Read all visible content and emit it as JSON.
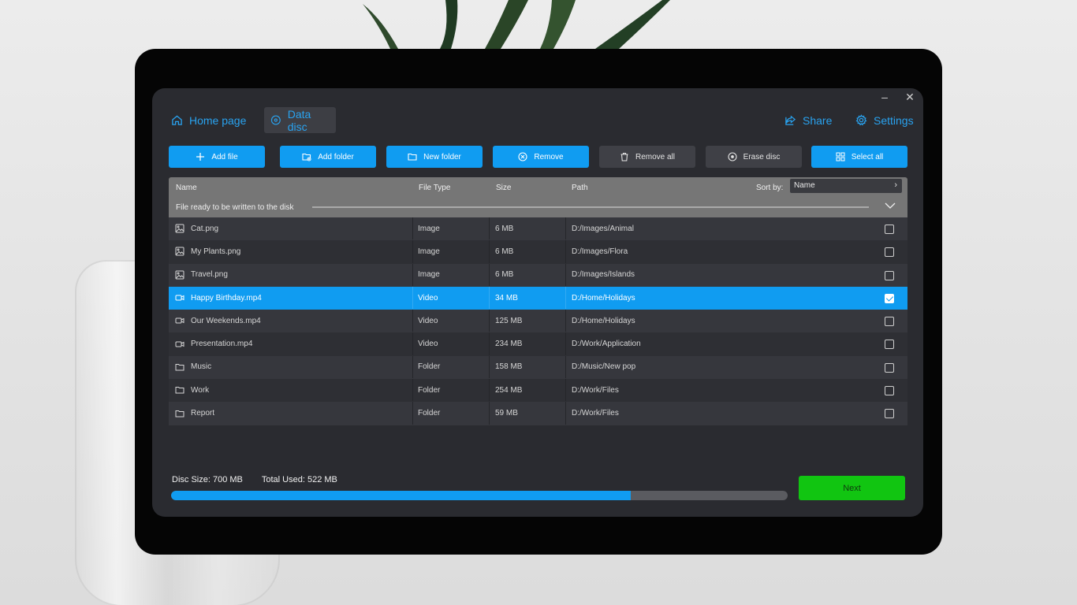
{
  "window": {
    "minimize_glyph": "–",
    "close_glyph": "✕"
  },
  "nav": {
    "home": {
      "label": "Home page",
      "icon": "home-icon"
    },
    "data_disc": {
      "label": "Data disc",
      "icon": "disc-icon",
      "active": true
    },
    "share": {
      "label": "Share",
      "icon": "share-icon"
    },
    "settings": {
      "label": "Settings",
      "icon": "gear-icon"
    }
  },
  "toolbar": {
    "add_file": "Add file",
    "add_folder": "Add folder",
    "new_folder": "New folder",
    "remove": "Remove",
    "remove_all": "Remove all",
    "erase_disc": "Erase disc",
    "select_all": "Select all"
  },
  "table": {
    "columns": {
      "name": "Name",
      "type": "File Type",
      "size": "Size",
      "path": "Path"
    },
    "sort_label": "Sort by:",
    "sort_value": "Name",
    "ready_text": "File ready to be written to the disk",
    "rows": [
      {
        "name": "Cat.png",
        "type": "Image",
        "size": "6 MB",
        "path": "D:/Images/Animal",
        "kind": "image",
        "checked": false
      },
      {
        "name": "My Plants.png",
        "type": "Image",
        "size": "6 MB",
        "path": "D:/Images/Flora",
        "kind": "image",
        "checked": false
      },
      {
        "name": "Travel.png",
        "type": "Image",
        "size": "6 MB",
        "path": "D:/Images/Islands",
        "kind": "image",
        "checked": false
      },
      {
        "name": "Happy Birthday.mp4",
        "type": "Video",
        "size": "34 MB",
        "path": "D:/Home/Holidays",
        "kind": "video",
        "checked": true
      },
      {
        "name": "Our Weekends.mp4",
        "type": "Video",
        "size": "125 MB",
        "path": "D:/Home/Holidays",
        "kind": "video",
        "checked": false
      },
      {
        "name": "Presentation.mp4",
        "type": "Video",
        "size": "234 MB",
        "path": "D:/Work/Application",
        "kind": "video",
        "checked": false
      },
      {
        "name": "Music",
        "type": "Folder",
        "size": "158 MB",
        "path": "D:/Music/New pop",
        "kind": "folder",
        "checked": false
      },
      {
        "name": "Work",
        "type": "Folder",
        "size": "254 MB",
        "path": "D:/Work/Files",
        "kind": "folder",
        "checked": false
      },
      {
        "name": "Report",
        "type": "Folder",
        "size": "59 MB",
        "path": "D:/Work/Files",
        "kind": "folder",
        "checked": false
      }
    ]
  },
  "footer": {
    "disc_size": "Disc Size: 700 MB",
    "total_used": "Total Used: 522 MB",
    "used_fraction": 0.7457,
    "next_label": "Next"
  },
  "colors": {
    "accent": "#109cf1",
    "next": "#11c511",
    "panel": "#2a2b30"
  }
}
